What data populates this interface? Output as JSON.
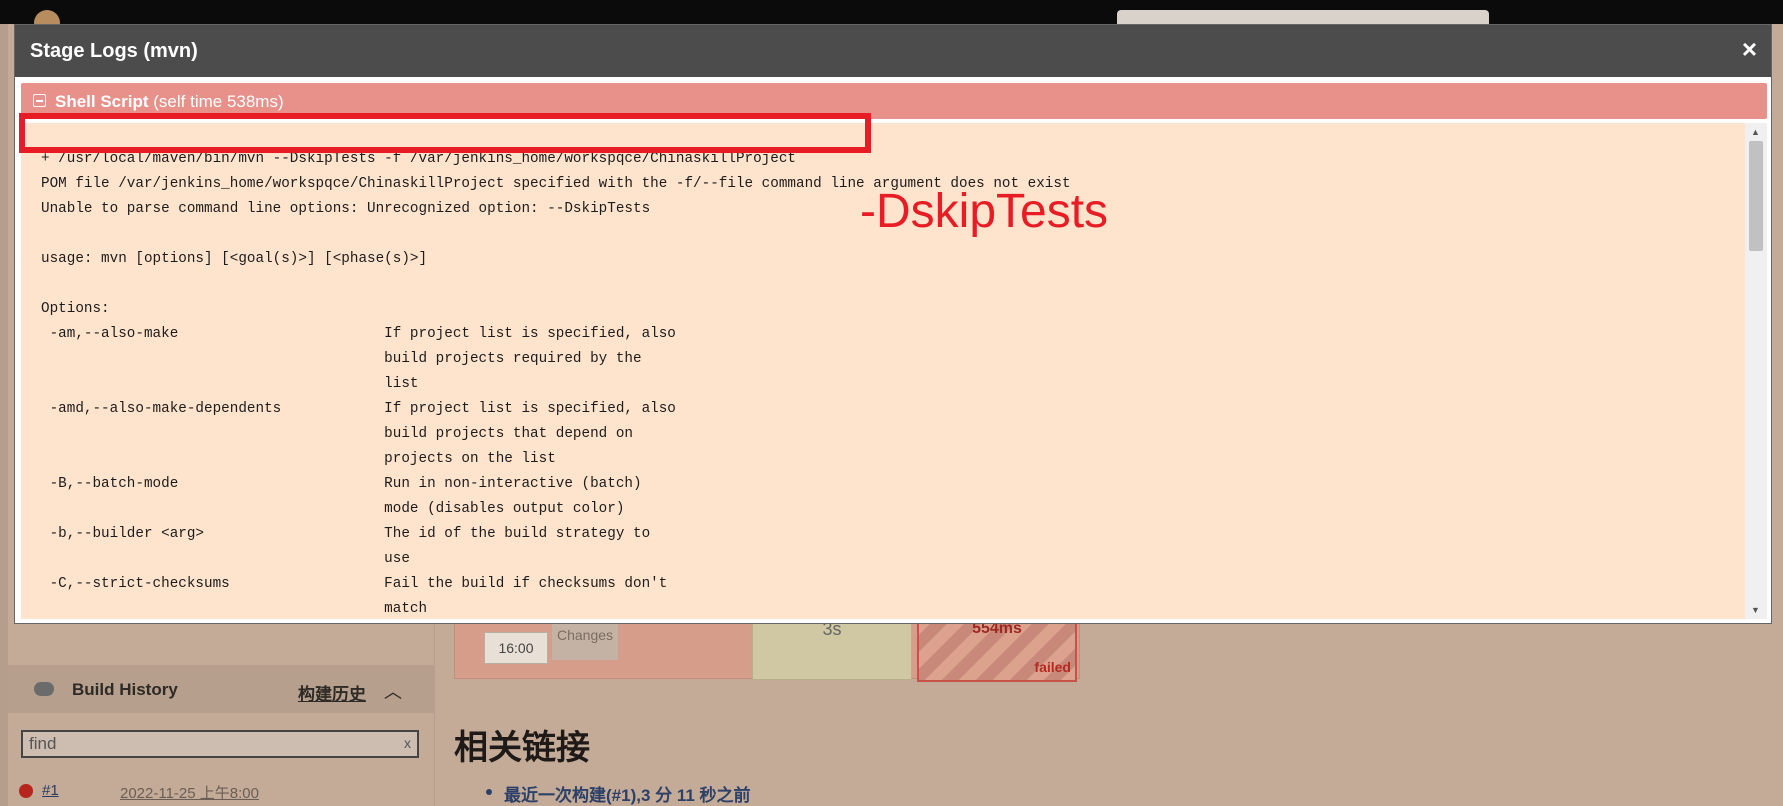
{
  "background": {
    "build_history": {
      "title": "Build History",
      "link": "构建历史",
      "search_value": "find",
      "clear": "x",
      "builds": [
        {
          "number": "#1",
          "date": "2022-11-25 上午8:00"
        }
      ]
    },
    "stage_view": {
      "time": "16:00",
      "changes": "Changes",
      "ok_cell_duration": "3s",
      "failed_cell_duration": "554ms",
      "failed_label": "failed"
    },
    "related_links": {
      "heading": "相关链接",
      "recent_build": "最近一次构建(#1),3 分 11 秒之前"
    }
  },
  "modal": {
    "title": "Stage Logs (mvn)",
    "close": "×",
    "step": {
      "name": "Shell Script",
      "self_time": "(self time 538ms)"
    },
    "log": "+ /usr/local/maven/bin/mvn --DskipTests -f /var/jenkins_home/workspqce/ChinaskillProject\nPOM file /var/jenkins_home/workspqce/ChinaskillProject specified with the -f/--file command line argument does not exist\nUnable to parse command line options: Unrecognized option: --DskipTests\n\nusage: mvn [options] [<goal(s)>] [<phase(s)>]\n\nOptions:\n -am,--also-make                        If project list is specified, also\n                                        build projects required by the\n                                        list\n -amd,--also-make-dependents            If project list is specified, also\n                                        build projects that depend on\n                                        projects on the list\n -B,--batch-mode                        Run in non-interactive (batch)\n                                        mode (disables output color)\n -b,--builder <arg>                     The id of the build strategy to\n                                        use\n -C,--strict-checksums                  Fail the build if checksums don't\n                                        match",
    "annotation": "-DskipTests"
  }
}
